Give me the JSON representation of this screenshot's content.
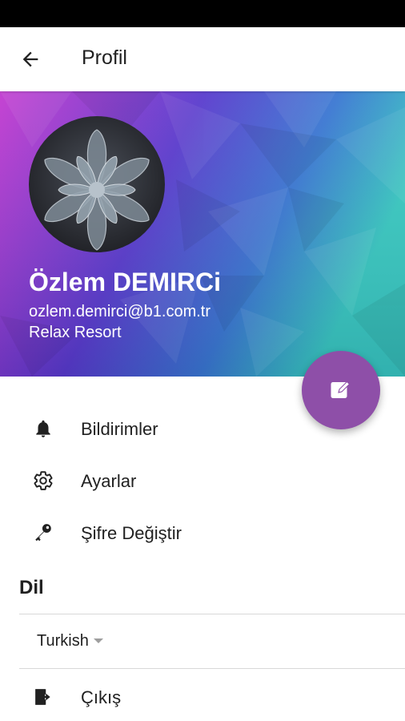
{
  "appbar": {
    "title": "Profil"
  },
  "profile": {
    "name": "Özlem DEMIRCi",
    "email": "ozlem.demirci@b1.com.tr",
    "company": "Relax Resort"
  },
  "menu": [
    {
      "label": "Bildirimler",
      "icon": "bell-icon"
    },
    {
      "label": "Ayarlar",
      "icon": "gear-icon"
    },
    {
      "label": "Şifre Değiştir",
      "icon": "key-icon"
    }
  ],
  "language": {
    "section_title": "Dil",
    "selected": "Turkish"
  },
  "logout": {
    "label": "Çıkış",
    "icon": "logout-icon"
  },
  "colors": {
    "accent": "#8e4fa8",
    "gradient_left": "#c23ad0",
    "gradient_mid": "#3c4fc9",
    "gradient_right": "#38c9c0"
  }
}
